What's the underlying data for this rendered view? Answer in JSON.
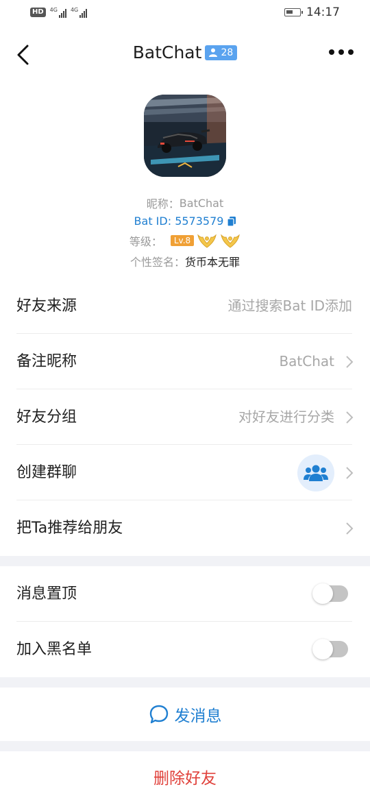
{
  "status_bar": {
    "hd": "HD",
    "net1": "4G",
    "net2": "4G",
    "time": "14:17"
  },
  "header": {
    "title": "BatChat",
    "member_count": "28"
  },
  "profile": {
    "nickname_label": "昵称：",
    "nickname": "BatChat",
    "bat_id": "Bat ID: 5573579",
    "level_label": "等级：",
    "level": "Lv.8",
    "signature_label": "个性签名：",
    "signature": "货币本无罪"
  },
  "settings": [
    {
      "label": "好友来源",
      "value": "通过搜索Bat ID添加"
    },
    {
      "label": "备注昵称",
      "value": "BatChat"
    },
    {
      "label": "好友分组",
      "value": "对好友进行分类"
    },
    {
      "label": "创建群聊",
      "value": ""
    },
    {
      "label": "把Ta推荐给朋友",
      "value": ""
    }
  ],
  "toggles": [
    {
      "label": "消息置顶",
      "on": false
    },
    {
      "label": "加入黑名单",
      "on": false
    }
  ],
  "actions": {
    "send_message": "发消息",
    "delete_friend": "删除好友"
  },
  "colors": {
    "accent": "#1f7fd1",
    "danger": "#e0403a",
    "badge": "#5aa3ef",
    "level": "#f0a035"
  }
}
